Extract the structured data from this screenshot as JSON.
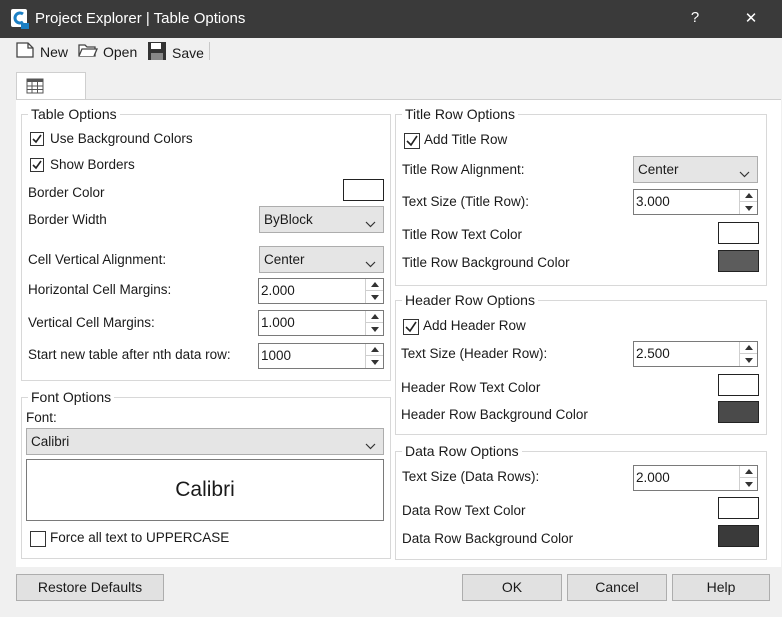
{
  "window": {
    "title": "Project Explorer | Table Options",
    "help_glyph": "?",
    "close_glyph": "✕"
  },
  "toolbar": {
    "new_label": "New",
    "open_label": "Open",
    "save_label": "Save"
  },
  "table_options": {
    "legend": "Table Options",
    "use_background_colors": {
      "label": "Use Background Colors",
      "checked": true
    },
    "show_borders": {
      "label": "Show Borders",
      "checked": true
    },
    "border_color_label": "Border Color",
    "border_color": "#ffffff",
    "border_width_label": "Border Width",
    "border_width_value": "ByBlock",
    "cell_vertical_alignment_label": "Cell Vertical Alignment:",
    "cell_vertical_alignment_value": "Center",
    "horizontal_margins_label": "Horizontal Cell Margins:",
    "horizontal_margins_value": "2.000",
    "vertical_margins_label": "Vertical Cell Margins:",
    "vertical_margins_value": "1.000",
    "start_new_table_label": "Start new table after nth data row:",
    "start_new_table_value": "1000"
  },
  "font_options": {
    "legend": "Font Options",
    "font_label": "Font:",
    "font_value": "Calibri",
    "preview_text": "Calibri",
    "uppercase": {
      "label": "Force all text to UPPERCASE",
      "checked": false
    }
  },
  "title_row": {
    "legend": "Title Row Options",
    "add": {
      "label": "Add Title Row",
      "checked": true
    },
    "alignment_label": "Title Row Alignment:",
    "alignment_value": "Center",
    "text_size_label": "Text Size (Title Row):",
    "text_size_value": "3.000",
    "text_color_label": "Title Row Text Color",
    "text_color": "#ffffff",
    "bg_color_label": "Title Row Background Color",
    "bg_color": "#5c5c5c"
  },
  "header_row": {
    "legend": "Header Row Options",
    "add": {
      "label": "Add Header Row",
      "checked": true
    },
    "text_size_label": "Text Size (Header Row):",
    "text_size_value": "2.500",
    "text_color_label": "Header Row Text Color",
    "text_color": "#ffffff",
    "bg_color_label": "Header Row Background Color",
    "bg_color": "#4a4a4a"
  },
  "data_row": {
    "legend": "Data Row Options",
    "text_size_label": "Text Size (Data Rows):",
    "text_size_value": "2.000",
    "text_color_label": "Data Row Text Color",
    "text_color": "#ffffff",
    "bg_color_label": "Data Row Background Color",
    "bg_color": "#3a3a3a"
  },
  "footer": {
    "restore_label": "Restore Defaults",
    "ok_label": "OK",
    "cancel_label": "Cancel",
    "help_label": "Help"
  }
}
